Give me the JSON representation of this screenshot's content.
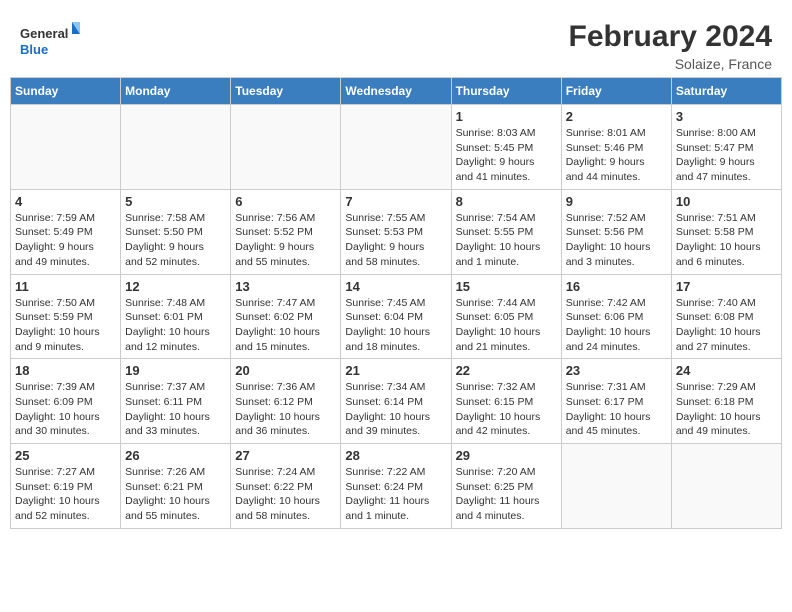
{
  "logo": {
    "general": "General",
    "blue": "Blue"
  },
  "title": "February 2024",
  "location": "Solaize, France",
  "days_of_week": [
    "Sunday",
    "Monday",
    "Tuesday",
    "Wednesday",
    "Thursday",
    "Friday",
    "Saturday"
  ],
  "weeks": [
    [
      {
        "day": "",
        "info": ""
      },
      {
        "day": "",
        "info": ""
      },
      {
        "day": "",
        "info": ""
      },
      {
        "day": "",
        "info": ""
      },
      {
        "day": "1",
        "info": "Sunrise: 8:03 AM\nSunset: 5:45 PM\nDaylight: 9 hours\nand 41 minutes."
      },
      {
        "day": "2",
        "info": "Sunrise: 8:01 AM\nSunset: 5:46 PM\nDaylight: 9 hours\nand 44 minutes."
      },
      {
        "day": "3",
        "info": "Sunrise: 8:00 AM\nSunset: 5:47 PM\nDaylight: 9 hours\nand 47 minutes."
      }
    ],
    [
      {
        "day": "4",
        "info": "Sunrise: 7:59 AM\nSunset: 5:49 PM\nDaylight: 9 hours\nand 49 minutes."
      },
      {
        "day": "5",
        "info": "Sunrise: 7:58 AM\nSunset: 5:50 PM\nDaylight: 9 hours\nand 52 minutes."
      },
      {
        "day": "6",
        "info": "Sunrise: 7:56 AM\nSunset: 5:52 PM\nDaylight: 9 hours\nand 55 minutes."
      },
      {
        "day": "7",
        "info": "Sunrise: 7:55 AM\nSunset: 5:53 PM\nDaylight: 9 hours\nand 58 minutes."
      },
      {
        "day": "8",
        "info": "Sunrise: 7:54 AM\nSunset: 5:55 PM\nDaylight: 10 hours\nand 1 minute."
      },
      {
        "day": "9",
        "info": "Sunrise: 7:52 AM\nSunset: 5:56 PM\nDaylight: 10 hours\nand 3 minutes."
      },
      {
        "day": "10",
        "info": "Sunrise: 7:51 AM\nSunset: 5:58 PM\nDaylight: 10 hours\nand 6 minutes."
      }
    ],
    [
      {
        "day": "11",
        "info": "Sunrise: 7:50 AM\nSunset: 5:59 PM\nDaylight: 10 hours\nand 9 minutes."
      },
      {
        "day": "12",
        "info": "Sunrise: 7:48 AM\nSunset: 6:01 PM\nDaylight: 10 hours\nand 12 minutes."
      },
      {
        "day": "13",
        "info": "Sunrise: 7:47 AM\nSunset: 6:02 PM\nDaylight: 10 hours\nand 15 minutes."
      },
      {
        "day": "14",
        "info": "Sunrise: 7:45 AM\nSunset: 6:04 PM\nDaylight: 10 hours\nand 18 minutes."
      },
      {
        "day": "15",
        "info": "Sunrise: 7:44 AM\nSunset: 6:05 PM\nDaylight: 10 hours\nand 21 minutes."
      },
      {
        "day": "16",
        "info": "Sunrise: 7:42 AM\nSunset: 6:06 PM\nDaylight: 10 hours\nand 24 minutes."
      },
      {
        "day": "17",
        "info": "Sunrise: 7:40 AM\nSunset: 6:08 PM\nDaylight: 10 hours\nand 27 minutes."
      }
    ],
    [
      {
        "day": "18",
        "info": "Sunrise: 7:39 AM\nSunset: 6:09 PM\nDaylight: 10 hours\nand 30 minutes."
      },
      {
        "day": "19",
        "info": "Sunrise: 7:37 AM\nSunset: 6:11 PM\nDaylight: 10 hours\nand 33 minutes."
      },
      {
        "day": "20",
        "info": "Sunrise: 7:36 AM\nSunset: 6:12 PM\nDaylight: 10 hours\nand 36 minutes."
      },
      {
        "day": "21",
        "info": "Sunrise: 7:34 AM\nSunset: 6:14 PM\nDaylight: 10 hours\nand 39 minutes."
      },
      {
        "day": "22",
        "info": "Sunrise: 7:32 AM\nSunset: 6:15 PM\nDaylight: 10 hours\nand 42 minutes."
      },
      {
        "day": "23",
        "info": "Sunrise: 7:31 AM\nSunset: 6:17 PM\nDaylight: 10 hours\nand 45 minutes."
      },
      {
        "day": "24",
        "info": "Sunrise: 7:29 AM\nSunset: 6:18 PM\nDaylight: 10 hours\nand 49 minutes."
      }
    ],
    [
      {
        "day": "25",
        "info": "Sunrise: 7:27 AM\nSunset: 6:19 PM\nDaylight: 10 hours\nand 52 minutes."
      },
      {
        "day": "26",
        "info": "Sunrise: 7:26 AM\nSunset: 6:21 PM\nDaylight: 10 hours\nand 55 minutes."
      },
      {
        "day": "27",
        "info": "Sunrise: 7:24 AM\nSunset: 6:22 PM\nDaylight: 10 hours\nand 58 minutes."
      },
      {
        "day": "28",
        "info": "Sunrise: 7:22 AM\nSunset: 6:24 PM\nDaylight: 11 hours\nand 1 minute."
      },
      {
        "day": "29",
        "info": "Sunrise: 7:20 AM\nSunset: 6:25 PM\nDaylight: 11 hours\nand 4 minutes."
      },
      {
        "day": "",
        "info": ""
      },
      {
        "day": "",
        "info": ""
      }
    ]
  ]
}
